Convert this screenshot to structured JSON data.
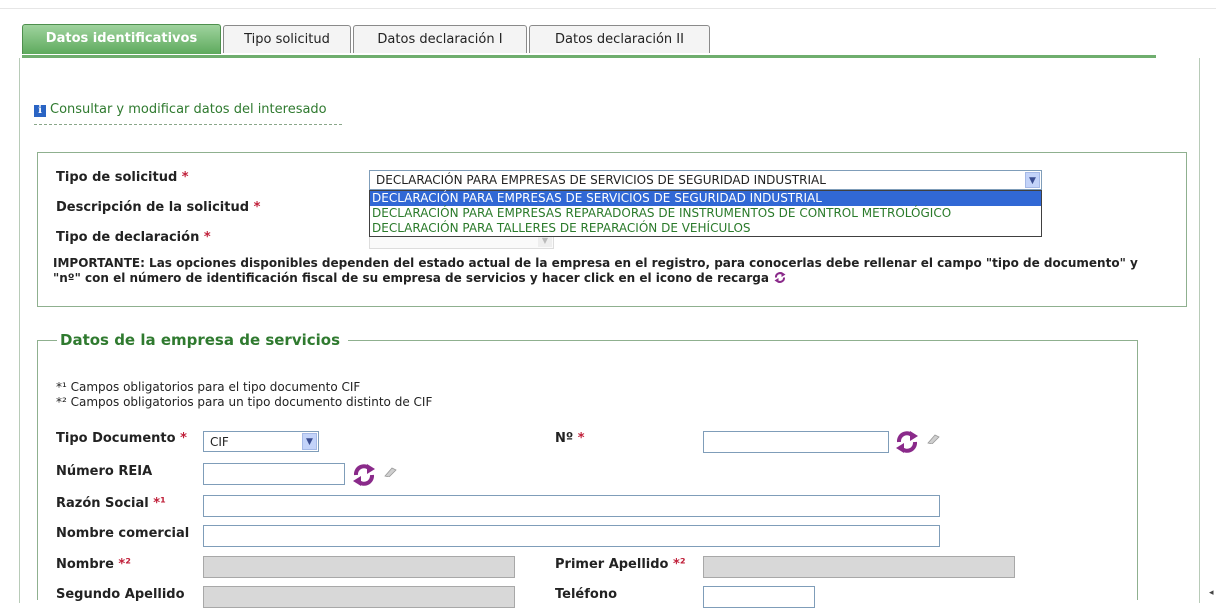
{
  "tabs": [
    {
      "label": "Datos identificativos"
    },
    {
      "label": "Tipo solicitud"
    },
    {
      "label": "Datos declaración I"
    },
    {
      "label": "Datos declaración II"
    }
  ],
  "info_link": "Consultar y modificar datos del interesado",
  "request": {
    "tipo_solicitud_label": "Tipo de solicitud",
    "descripcion_label": "Descripción de la solicitud",
    "tipo_declaracion_label": "Tipo de declaración",
    "required_mark": "*",
    "tipo_solicitud_value": "DECLARACIÓN PARA EMPRESAS DE SERVICIOS DE SEGURIDAD INDUSTRIAL",
    "options": [
      "DECLARACIÓN PARA EMPRESAS DE SERVICIOS DE SEGURIDAD INDUSTRIAL",
      "DECLARACIÓN PARA EMPRESAS REPARADORAS DE INSTRUMENTOS DE CONTROL METROLÓGICO",
      "DECLARACIÓN PARA TALLERES DE REPARACIÓN DE VEHÍCULOS"
    ],
    "important_text": "IMPORTANTE: Las opciones disponibles dependen del estado actual de la empresa en el registro, para conocerlas debe rellenar el campo \"tipo de documento\" y \"nº\" con el número de identificación fiscal de su empresa de servicios y hacer click en el icono de recarga"
  },
  "company": {
    "legend": "Datos de la empresa de servicios",
    "note1": "*¹ Campos obligatorios para el tipo documento CIF",
    "note2": "*² Campos obligatorios para un tipo documento distinto de CIF",
    "tipo_documento_label": "Tipo Documento",
    "tipo_documento_value": "CIF",
    "numero_label": "Nº",
    "numero_reia_label": "Número REIA",
    "razon_social_label": "Razón Social",
    "razon_social_mark": "*¹",
    "nombre_comercial_label": "Nombre comercial",
    "nombre_label": "Nombre",
    "nombre_mark": "*²",
    "primer_apellido_label": "Primer Apellido",
    "primer_apellido_mark": "*²",
    "segundo_apellido_label": "Segundo Apellido",
    "telefono_label": "Teléfono"
  },
  "colors": {
    "accent": "#5eaa5d",
    "required": "#c0203a",
    "link": "#2f7a2f",
    "reload": "#8a2a8a"
  },
  "icons": [
    "info-icon",
    "reload-icon",
    "eraser-icon",
    "chevron-down-icon"
  ]
}
